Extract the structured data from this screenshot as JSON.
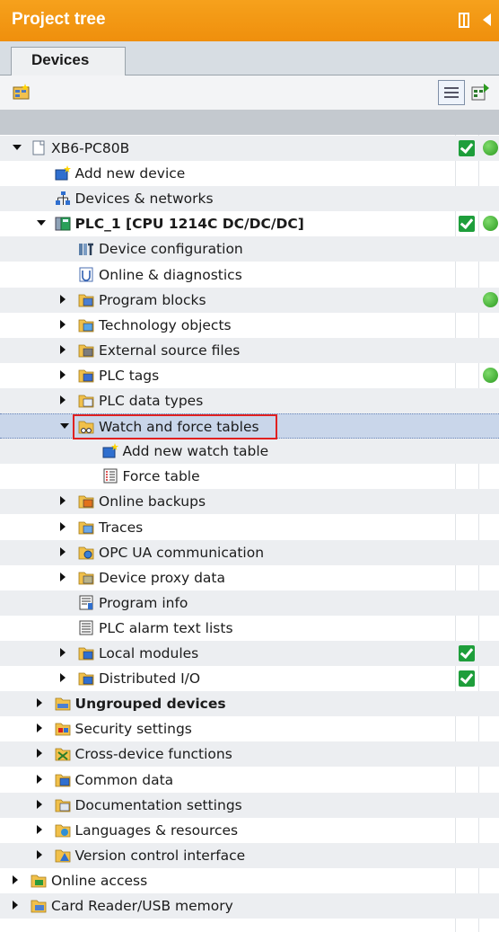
{
  "panel": {
    "title": "Project tree",
    "tab_label": "Devices",
    "icons": {
      "pin": "pin-icon",
      "collapse": "collapse-left-icon",
      "add_folder": "new-group-icon",
      "detail_view": "detail-view-icon",
      "overview": "overview-icon"
    }
  },
  "colors": {
    "title_bar": "#f39a15",
    "selection": "#c9d6ea",
    "highlight_box": "#e02020",
    "status_green": "#1e9e3b"
  },
  "tree": [
    {
      "label": "XB6-PC80B",
      "expanded": true,
      "icon": "project-icon",
      "status_check": true,
      "status_dot": true
    },
    {
      "label": "Add new device",
      "icon": "add-device-icon"
    },
    {
      "label": "Devices & networks",
      "icon": "network-icon"
    },
    {
      "label": "PLC_1 [CPU 1214C DC/DC/DC]",
      "expanded": true,
      "icon": "plc-icon",
      "bold": true,
      "status_check": true,
      "status_dot": true
    },
    {
      "label": "Device configuration",
      "icon": "device-config-icon"
    },
    {
      "label": "Online & diagnostics",
      "icon": "diagnostics-icon"
    },
    {
      "label": "Program blocks",
      "expandable": true,
      "icon": "program-blocks-icon",
      "status_dot": true
    },
    {
      "label": "Technology objects",
      "expandable": true,
      "icon": "technology-objects-icon"
    },
    {
      "label": "External source files",
      "expandable": true,
      "icon": "external-source-icon"
    },
    {
      "label": "PLC tags",
      "expandable": true,
      "icon": "plc-tags-icon",
      "status_dot": true
    },
    {
      "label": "PLC data types",
      "expandable": true,
      "icon": "data-types-icon"
    },
    {
      "label": "Watch and force tables",
      "expanded": true,
      "selected": true,
      "highlighted": true,
      "icon": "watch-tables-icon"
    },
    {
      "label": "Add new watch table",
      "icon": "add-watch-table-icon"
    },
    {
      "label": "Force table",
      "icon": "force-table-icon"
    },
    {
      "label": "Online backups",
      "expandable": true,
      "icon": "backups-icon"
    },
    {
      "label": "Traces",
      "expandable": true,
      "icon": "traces-icon"
    },
    {
      "label": "OPC UA communication",
      "expandable": true,
      "icon": "opc-ua-icon"
    },
    {
      "label": "Device proxy data",
      "expandable": true,
      "icon": "proxy-data-icon"
    },
    {
      "label": "Program info",
      "icon": "program-info-icon"
    },
    {
      "label": "PLC alarm text lists",
      "icon": "alarm-text-icon"
    },
    {
      "label": "Local modules",
      "expandable": true,
      "icon": "local-modules-icon",
      "status_check": true
    },
    {
      "label": "Distributed I/O",
      "expandable": true,
      "icon": "distributed-io-icon",
      "status_check": true
    },
    {
      "label": "Ungrouped devices",
      "expandable": true,
      "icon": "ungrouped-devices-icon",
      "bold": true
    },
    {
      "label": "Security settings",
      "expandable": true,
      "icon": "security-icon"
    },
    {
      "label": "Cross-device functions",
      "expandable": true,
      "icon": "cross-device-icon"
    },
    {
      "label": "Common data",
      "expandable": true,
      "icon": "common-data-icon"
    },
    {
      "label": "Documentation settings",
      "expandable": true,
      "icon": "documentation-icon"
    },
    {
      "label": "Languages & resources",
      "expandable": true,
      "icon": "languages-icon"
    },
    {
      "label": "Version control interface",
      "expandable": true,
      "icon": "version-control-icon"
    },
    {
      "label": "Online access",
      "expandable": true,
      "icon": "online-access-icon"
    },
    {
      "label": "Card Reader/USB memory",
      "expandable": true,
      "icon": "card-reader-icon"
    }
  ]
}
